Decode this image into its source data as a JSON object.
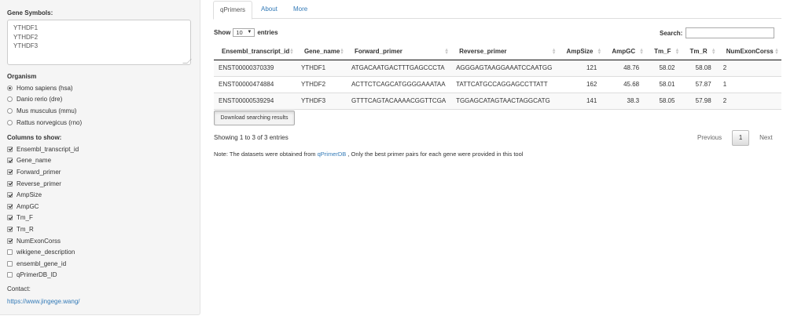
{
  "sidebar": {
    "gene_symbols_label": "Gene Symbols:",
    "gene_symbols_value": "YTHDF1\nYTHDF2\nYTHDF3",
    "organism_label": "Organism",
    "organisms": [
      {
        "label": "Homo sapiens (hsa)",
        "selected": true
      },
      {
        "label": "Danio rerio (dre)",
        "selected": false
      },
      {
        "label": "Mus musculus (mmu)",
        "selected": false
      },
      {
        "label": "Rattus norvegicus (rno)",
        "selected": false
      }
    ],
    "columns_label": "Columns to show:",
    "columns": [
      {
        "label": "Ensembl_transcript_id",
        "checked": true
      },
      {
        "label": "Gene_name",
        "checked": true
      },
      {
        "label": "Forward_primer",
        "checked": true
      },
      {
        "label": "Reverse_primer",
        "checked": true
      },
      {
        "label": "AmpSize",
        "checked": true
      },
      {
        "label": "AmpGC",
        "checked": true
      },
      {
        "label": "Tm_F",
        "checked": true
      },
      {
        "label": "Tm_R",
        "checked": true
      },
      {
        "label": "NumExonCorss",
        "checked": true
      },
      {
        "label": "wikigene_description",
        "checked": false
      },
      {
        "label": "ensembl_gene_id",
        "checked": false
      },
      {
        "label": "qPrimerDB_ID",
        "checked": false
      }
    ],
    "contact_label": "Contact:",
    "contact_link": "https://www.jingege.wang/"
  },
  "tabs": [
    {
      "label": "qPrimers",
      "active": true
    },
    {
      "label": "About",
      "active": false
    },
    {
      "label": "More",
      "active": false
    }
  ],
  "table_controls": {
    "show_label": "Show",
    "page_length": "10",
    "entries_label": "entries",
    "search_label": "Search:",
    "search_value": ""
  },
  "table": {
    "headers": [
      "Ensembl_transcript_id",
      "Gene_name",
      "Forward_primer",
      "Reverse_primer",
      "AmpSize",
      "AmpGC",
      "Tm_F",
      "Tm_R",
      "NumExonCorss"
    ],
    "rows": [
      [
        "ENST00000370339",
        "YTHDF1",
        "ATGACAATGACTTTGAGCCCTA",
        "AGGGAGTAAGGAAATCCAATGG",
        "121",
        "48.76",
        "58.02",
        "58.08",
        "2"
      ],
      [
        "ENST00000474884",
        "YTHDF2",
        "ACTTCTCAGCATGGGGAAATAA",
        "TATTCATGCCAGGAGCCTTATT",
        "162",
        "45.68",
        "58.01",
        "57.87",
        "1"
      ],
      [
        "ENST00000539294",
        "YTHDF3",
        "GTTTCAGTACAAAACGGTTCGA",
        "TGGAGCATAGTAACTAGGCATG",
        "141",
        "38.3",
        "58.05",
        "57.98",
        "2"
      ]
    ]
  },
  "download_button": "Download searching results",
  "info_text": "Showing 1 to 3 of 3 entries",
  "pagination": {
    "previous": "Previous",
    "page": "1",
    "next": "Next"
  },
  "note": {
    "prefix": "Note: The datasets were obtained from ",
    "link": "qPrimerDB",
    "suffix": " , Only the best primer pairs for each gene were provided in this tool"
  }
}
